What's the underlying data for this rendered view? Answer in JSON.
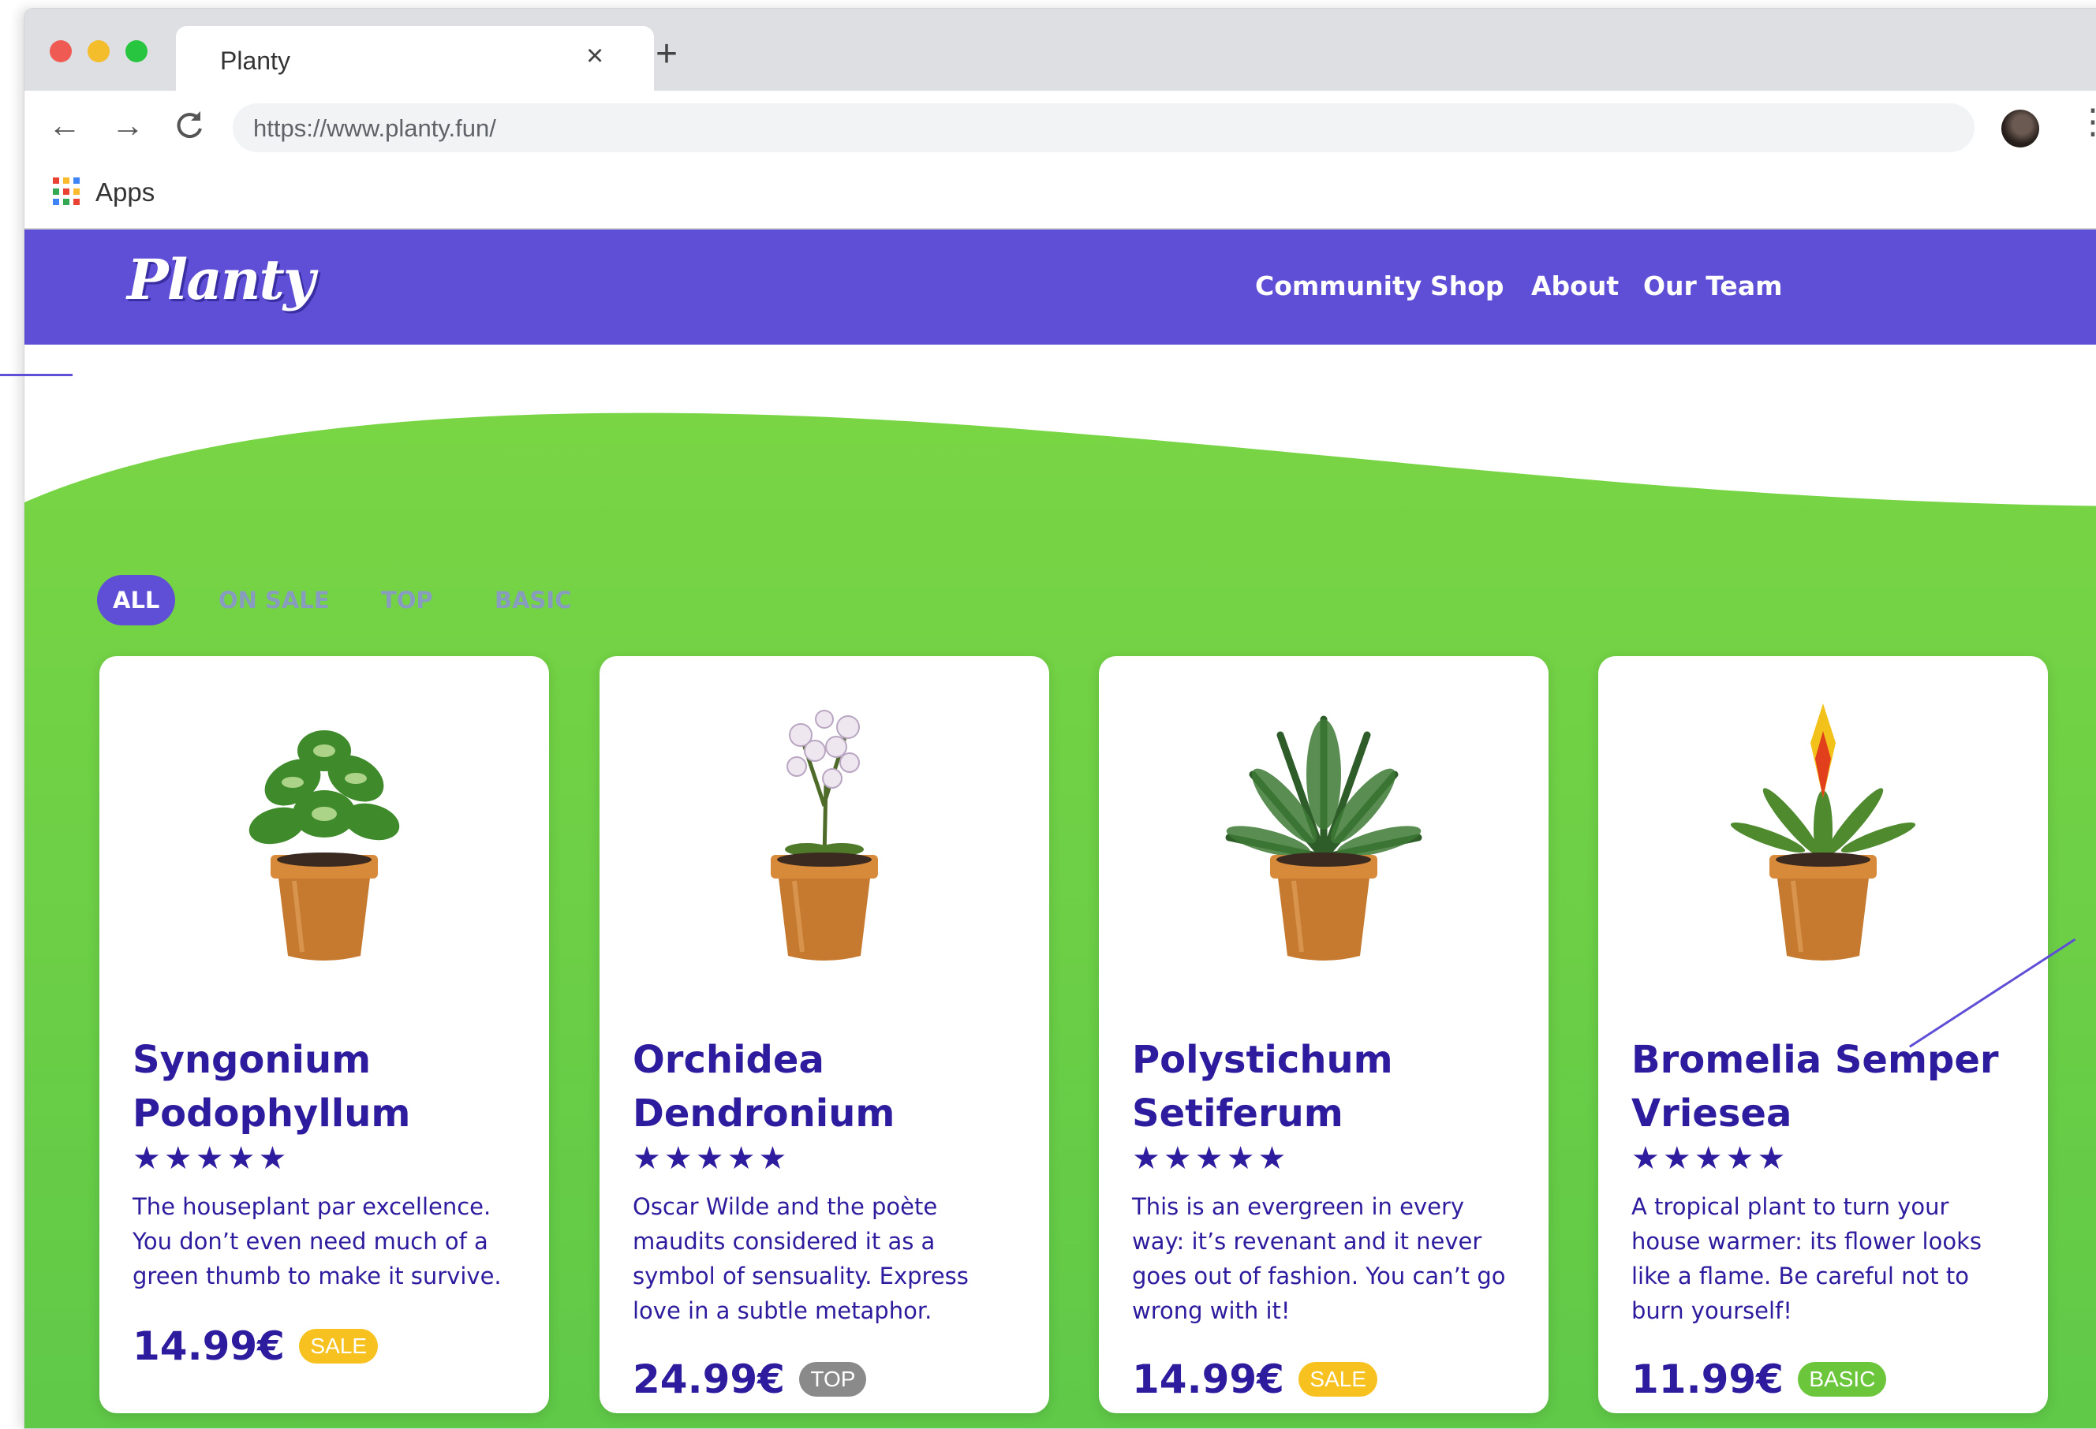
{
  "browser": {
    "tab_title": "Planty",
    "tab_close": "×",
    "new_tab": "+",
    "back": "←",
    "forward": "→",
    "reload": "C",
    "url": "https://www.planty.fun/",
    "menu": "⋮",
    "bookmark_apps": "Apps"
  },
  "site": {
    "logo": "Planty",
    "nav": [
      "Community",
      "Shop",
      "About",
      "Our Team"
    ],
    "filters": [
      "ALL",
      "ON SALE",
      "TOP",
      "BASIC"
    ],
    "active_filter": "ALL",
    "colors": {
      "brand": "#5e4fd6",
      "green": "#79d544",
      "text": "#2d1c9e",
      "sale": "#f7c21f",
      "top": "#8a8a8a",
      "basic": "#6bc63b"
    },
    "products": [
      {
        "name": "Syngonium Podophyllum",
        "rating": "★★★★★",
        "description": "The houseplant par excellence. You don’t even need much of a green thumb to make it survive.",
        "price": "14.99€",
        "badge": "SALE",
        "icon": "syngonium-plant-icon"
      },
      {
        "name": "Orchidea Dendronium",
        "rating": "★★★★★",
        "description": "Oscar Wilde and the poète maudits considered it as a symbol of sensuality. Express love in a subtle metaphor.",
        "price": "24.99€",
        "badge": "TOP",
        "icon": "orchid-plant-icon"
      },
      {
        "name": "Polystichum Setiferum",
        "rating": "★★★★★",
        "description": "This is an evergreen in every way: it’s revenant and it never goes out of fashion. You can’t go wrong with it!",
        "price": "14.99€",
        "badge": "SALE",
        "icon": "fern-plant-icon"
      },
      {
        "name": "Bromelia Semper Vriesea",
        "rating": "★★★★★",
        "description": "A tropical plant to turn your house warmer: its flower looks like a flame. Be careful not to burn yourself!",
        "price": "11.99€",
        "badge": "BASIC",
        "icon": "bromelia-plant-icon"
      }
    ]
  }
}
